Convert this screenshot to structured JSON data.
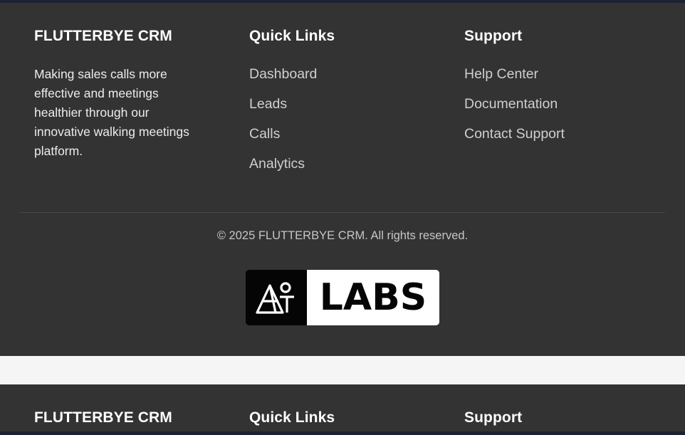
{
  "footer": {
    "brand": {
      "title": "FLUTTERBYE CRM",
      "description": "Making sales calls more effective and meetings healthier through our innovative walking meetings platform."
    },
    "quick_links": {
      "title": "Quick Links",
      "items": [
        "Dashboard",
        "Leads",
        "Calls",
        "Analytics"
      ]
    },
    "support": {
      "title": "Support",
      "items": [
        "Help Center",
        "Documentation",
        "Contact Support"
      ]
    },
    "copyright": "© 2025 FLUTTERBYE CRM. All rights reserved.",
    "logo": {
      "text": "LABS",
      "mark_icon": "at-labs-logo-icon"
    }
  },
  "colors": {
    "footer_bg": "#333333",
    "page_bg": "#f5f5f5",
    "top_bar": "#1c2133",
    "heading": "#ffffff",
    "link": "#cfcfcf"
  }
}
